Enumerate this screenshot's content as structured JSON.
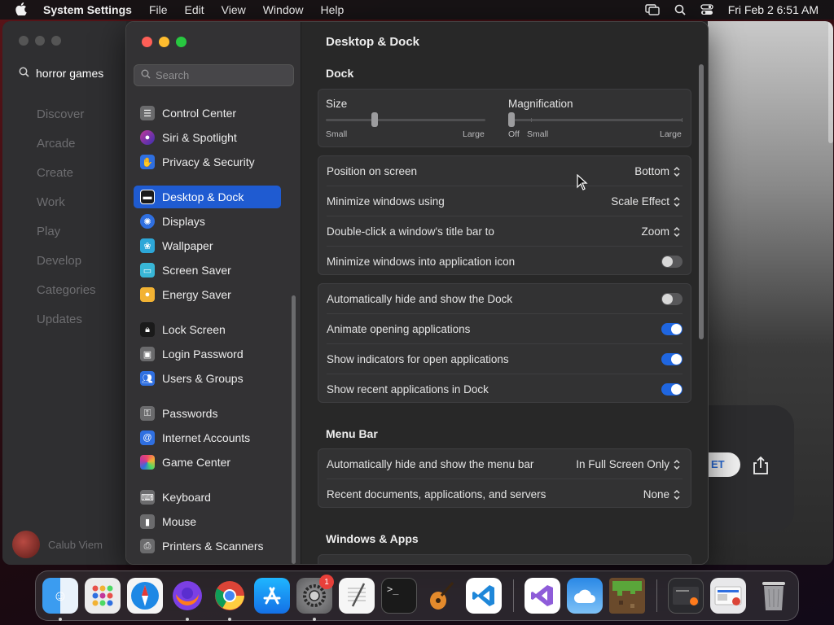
{
  "menubar": {
    "app": "System Settings",
    "items": [
      "File",
      "Edit",
      "View",
      "Window",
      "Help"
    ],
    "clock": "Fri Feb 2  6:51 AM"
  },
  "background_app": {
    "search_value": "horror games",
    "nav": [
      "Discover",
      "Arcade",
      "Create",
      "Work",
      "Play",
      "Develop",
      "Categories",
      "Updates"
    ],
    "user": "Calub Viem",
    "get_label": "ET"
  },
  "sidebar": {
    "search_placeholder": "Search",
    "items": [
      {
        "label": "Control Center",
        "color": "#6b6b6d"
      },
      {
        "label": "Siri & Spotlight",
        "color": "#b3389e"
      },
      {
        "label": "Privacy & Security",
        "color": "#2f6fe0"
      },
      {
        "label": "Desktop & Dock",
        "color": "#1a1a1a"
      },
      {
        "label": "Displays",
        "color": "#2f6fe0"
      },
      {
        "label": "Wallpaper",
        "color": "#2da7d8"
      },
      {
        "label": "Screen Saver",
        "color": "#38b6d6"
      },
      {
        "label": "Energy Saver",
        "color": "#f2b233"
      },
      {
        "label": "Lock Screen",
        "color": "#1a1a1a"
      },
      {
        "label": "Login Password",
        "color": "#6b6b6d"
      },
      {
        "label": "Users & Groups",
        "color": "#2f6fe0"
      },
      {
        "label": "Passwords",
        "color": "#6b6b6d"
      },
      {
        "label": "Internet Accounts",
        "color": "#2f6fe0"
      },
      {
        "label": "Game Center",
        "color": "#e8e8e8"
      },
      {
        "label": "Keyboard",
        "color": "#6b6b6d"
      },
      {
        "label": "Mouse",
        "color": "#6b6b6d"
      },
      {
        "label": "Printers & Scanners",
        "color": "#6b6b6d"
      }
    ],
    "selected": "Desktop & Dock"
  },
  "main": {
    "title": "Desktop & Dock",
    "dock_section": "Dock",
    "size": {
      "label": "Size",
      "min": "Small",
      "max": "Large",
      "value": 0.3
    },
    "magnification": {
      "label": "Magnification",
      "off": "Off",
      "min": "Small",
      "max": "Large",
      "value": 0.0
    },
    "dock_rows": [
      {
        "label": "Position on screen",
        "value": "Bottom"
      },
      {
        "label": "Minimize windows using",
        "value": "Scale Effect"
      },
      {
        "label": "Double-click a window's title bar to",
        "value": "Zoom"
      },
      {
        "label": "Minimize windows into application icon",
        "toggle": false
      }
    ],
    "dock_toggles": [
      {
        "label": "Automatically hide and show the Dock",
        "toggle": false
      },
      {
        "label": "Animate opening applications",
        "toggle": true
      },
      {
        "label": "Show indicators for open applications",
        "toggle": true
      },
      {
        "label": "Show recent applications in Dock",
        "toggle": true
      }
    ],
    "menubar_section": "Menu Bar",
    "menubar_rows": [
      {
        "label": "Automatically hide and show the menu bar",
        "value": "In Full Screen Only"
      },
      {
        "label": "Recent documents, applications, and servers",
        "value": "None"
      }
    ],
    "windows_section": "Windows & Apps"
  },
  "dock": {
    "apps": [
      "Finder",
      "Launchpad",
      "Safari",
      "Firefox",
      "Chrome",
      "App Store",
      "System Settings",
      "TextEdit",
      "Terminal",
      "GarageBand",
      "VS Code",
      "Visual Studio",
      "Weather",
      "Minecraft",
      "Window Preview",
      "Window Preview",
      "Trash"
    ],
    "settings_badge": "1"
  }
}
